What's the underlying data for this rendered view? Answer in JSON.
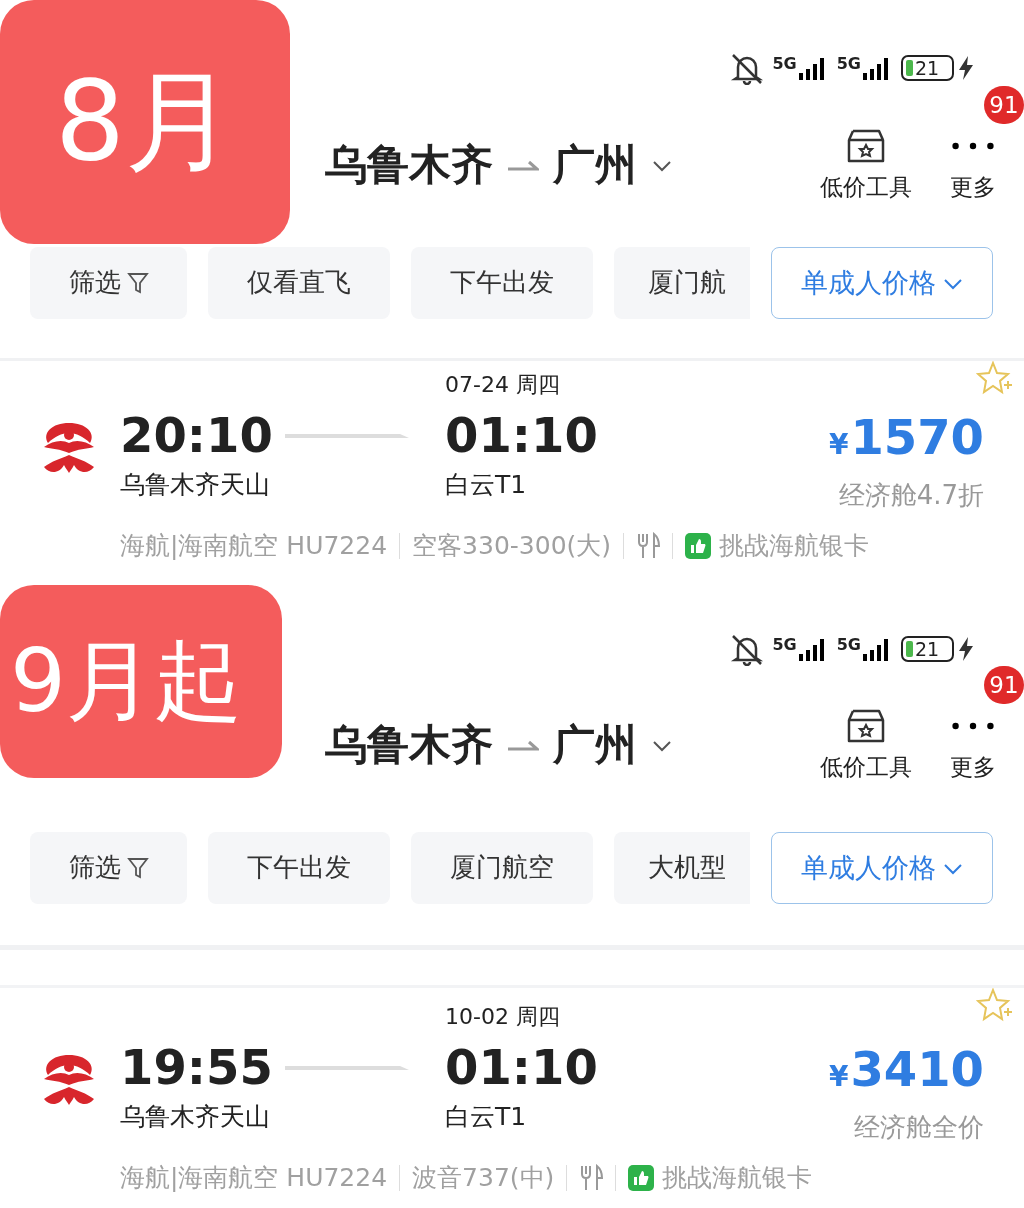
{
  "panels": [
    {
      "label": "8月",
      "status": {
        "network_1": "5G",
        "network_2": "5G",
        "battery": "21"
      },
      "route": {
        "from": "乌鲁木齐",
        "to": "广州"
      },
      "tools": [
        {
          "label": "低价工具",
          "kind": "box"
        },
        {
          "label": "更多",
          "kind": "more",
          "badge": "91"
        }
      ],
      "filters": [
        {
          "label": "筛选",
          "kind": "filter"
        },
        {
          "label": "仅看直飞",
          "kind": "plain"
        },
        {
          "label": "下午出发",
          "kind": "plain"
        },
        {
          "label": "厦门航",
          "kind": "plain"
        }
      ],
      "price_mode": "单成人价格",
      "flight": {
        "date": "07-24 周四",
        "depart_time": "20:10",
        "depart_airport": "乌鲁木齐天山",
        "arrive_time": "01:10",
        "arrive_airport": "白云T1",
        "currency": "¥",
        "price": "1570",
        "fare": "经济舱4.7折",
        "airline": "海航|海南航空 HU7224",
        "aircraft": "空客330-300(大)",
        "promo": "挑战海航银卡"
      }
    },
    {
      "label": "9月起",
      "status": {
        "network_1": "5G",
        "network_2": "5G",
        "battery": "21"
      },
      "route": {
        "from": "乌鲁木齐",
        "to": "广州"
      },
      "tools": [
        {
          "label": "低价工具",
          "kind": "box"
        },
        {
          "label": "更多",
          "kind": "more",
          "badge": "91"
        }
      ],
      "filters": [
        {
          "label": "筛选",
          "kind": "filter"
        },
        {
          "label": "下午出发",
          "kind": "plain"
        },
        {
          "label": "厦门航空",
          "kind": "plain"
        },
        {
          "label": "大机型",
          "kind": "plain"
        }
      ],
      "price_mode": "单成人价格",
      "flight": {
        "date": "10-02 周四",
        "depart_time": "19:55",
        "depart_airport": "乌鲁木齐天山",
        "arrive_time": "01:10",
        "arrive_airport": "白云T1",
        "currency": "¥",
        "price": "3410",
        "fare": "经济舱全价",
        "airline": "海航|海南航空 HU7224",
        "aircraft": "波音737(中)",
        "promo": "挑战海航银卡"
      }
    }
  ]
}
